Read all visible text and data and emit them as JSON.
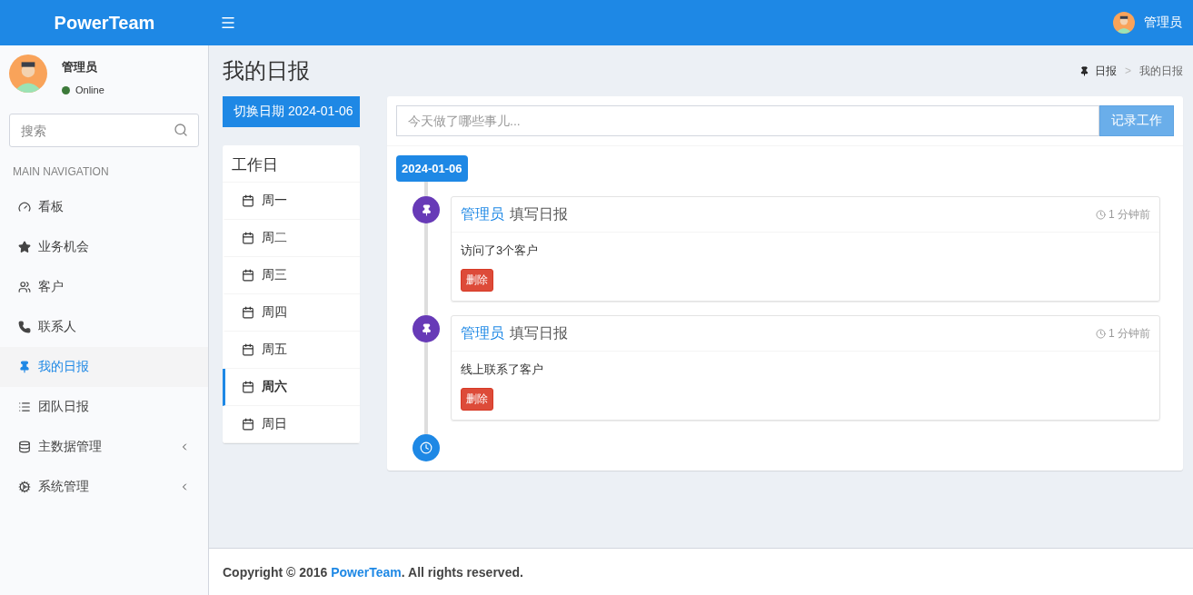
{
  "header": {
    "brand": "PowerTeam",
    "user_name": "管理员"
  },
  "sidebar": {
    "user": {
      "name": "管理员",
      "status": "Online"
    },
    "search": {
      "placeholder": "搜索"
    },
    "heading": "MAIN NAVIGATION",
    "items": [
      {
        "label": "看板",
        "kind": "dashboard",
        "selected": false,
        "has_submenu": false
      },
      {
        "label": "业务机会",
        "kind": "star",
        "selected": false,
        "has_submenu": false
      },
      {
        "label": "客户",
        "kind": "users",
        "selected": false,
        "has_submenu": false
      },
      {
        "label": "联系人",
        "kind": "phone",
        "selected": false,
        "has_submenu": false
      },
      {
        "label": "我的日报",
        "kind": "pin",
        "selected": true,
        "has_submenu": false
      },
      {
        "label": "团队日报",
        "kind": "list",
        "selected": false,
        "has_submenu": false
      },
      {
        "label": "主数据管理",
        "kind": "database",
        "selected": false,
        "has_submenu": true
      },
      {
        "label": "系统管理",
        "kind": "gears",
        "selected": false,
        "has_submenu": true
      }
    ]
  },
  "page": {
    "title": "我的日报",
    "breadcrumb": [
      "日报",
      "我的日报"
    ],
    "separator": ">"
  },
  "date_button": {
    "label": "切换日期 2024-01-06"
  },
  "weekdays": {
    "title": "工作日",
    "items": [
      {
        "label": "周一",
        "selected": false
      },
      {
        "label": "周二",
        "selected": false
      },
      {
        "label": "周三",
        "selected": false
      },
      {
        "label": "周四",
        "selected": false
      },
      {
        "label": "周五",
        "selected": false
      },
      {
        "label": "周六",
        "selected": true
      },
      {
        "label": "周日",
        "selected": false
      }
    ]
  },
  "log": {
    "input": {
      "placeholder": "今天做了哪些事儿..."
    },
    "submit": "记录工作",
    "date_label": "2024-01-06",
    "entries": [
      {
        "author": "管理员",
        "action": "填写日报",
        "time": "1 分钟前",
        "body": "访问了3个客户",
        "delete": "删除"
      },
      {
        "author": "管理员",
        "action": "填写日报",
        "time": "1 分钟前",
        "body": "线上联系了客户",
        "delete": "删除"
      }
    ]
  },
  "footer": {
    "prefix": "Copyright © 2016 ",
    "link": "PowerTeam",
    "suffix": ". All rights reserved."
  }
}
